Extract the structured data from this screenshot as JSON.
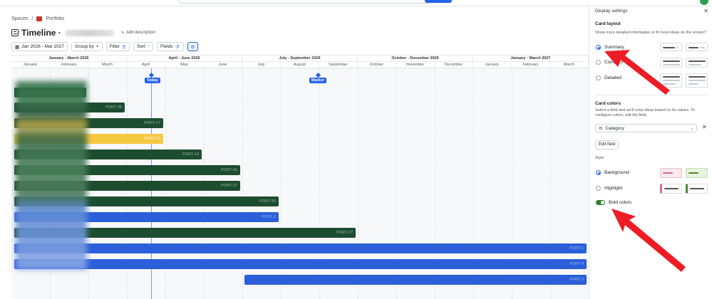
{
  "breadcrumb": {
    "spaces": "Spaces",
    "sep": "/",
    "portfolio": "Portfolio"
  },
  "header": {
    "title": "Timeline ·",
    "add_description": "Add description"
  },
  "toolbar": {
    "date_range": "Jan 2026 - Mar 2027",
    "group_by": "Group by",
    "filter": "Filter",
    "sort": "Sort",
    "fields": "Fields",
    "fields_count": "3"
  },
  "timeline": {
    "quarters": [
      "January - March 2026",
      "April - June 2026",
      "July - September 2026",
      "October - December 2026",
      "January - March 2027"
    ],
    "months": [
      "January",
      "February",
      "March",
      "April",
      "May",
      "June",
      "July",
      "August",
      "September",
      "October",
      "November",
      "December",
      "January",
      "February",
      "March"
    ],
    "today_label": "Today",
    "marker_label": "Marker",
    "bars": [
      {
        "label": "",
        "color": "green"
      },
      {
        "label": "PORT-28",
        "color": "green"
      },
      {
        "label": "PORT-17",
        "color": "green"
      },
      {
        "label": "PORT-16",
        "color": "yellow"
      },
      {
        "label": "PORT-14",
        "color": "green"
      },
      {
        "label": "PORT-41",
        "color": "green"
      },
      {
        "label": "PORT-37",
        "color": "green"
      },
      {
        "label": "PORT-56",
        "color": "green"
      },
      {
        "label": "PORT-2",
        "color": "blue"
      },
      {
        "label": "PORT-27",
        "color": "green"
      },
      {
        "label": "PORT-1",
        "color": "blue"
      },
      {
        "label": "PORT-4",
        "color": "blue"
      },
      {
        "label": "PORT-3",
        "color": "blue"
      }
    ]
  },
  "panel": {
    "title": "Display settings",
    "card_layout": {
      "heading": "Card layout",
      "description": "Show more detailed information or fit more ideas on the screen?",
      "options": [
        "Summary",
        "Compact",
        "Detailed"
      ],
      "selected": "Summary"
    },
    "card_colors": {
      "heading": "Card colors",
      "description": "Select a field and we'll color ideas based on its values. To configure colors, edit the field.",
      "field": "Category",
      "edit_field": "Edit field"
    },
    "style": {
      "heading": "Style",
      "options": [
        "Background",
        "Highlight"
      ],
      "selected": "Background",
      "bold_colors": "Bold colors",
      "bold_colors_on": true
    }
  },
  "colors": {
    "accent": "#2563eb",
    "green_bar": "#1d4d30",
    "yellow_bar": "#f5c842",
    "blue_bar": "#2b5fd9",
    "arrow": "#ee1c25"
  }
}
